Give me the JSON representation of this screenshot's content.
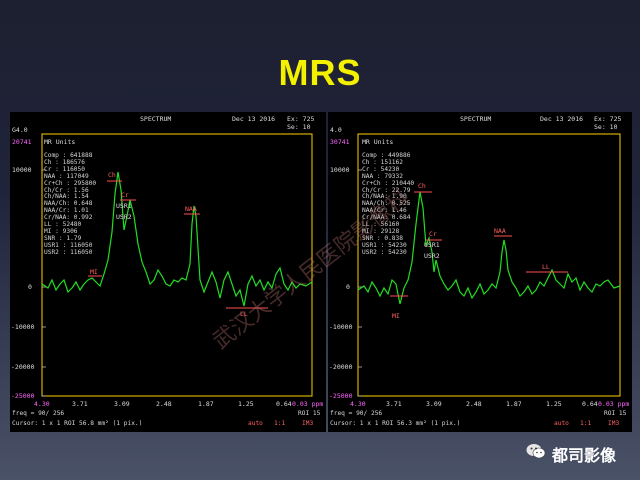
{
  "slide": {
    "title": "MRS"
  },
  "watermark": "武汉大学人民医院影像科",
  "logo": {
    "text": "都司影像",
    "icon": "wechat-icon"
  },
  "accent_color": "#f3f000",
  "spectrum_color": "#22dd22",
  "panels": [
    {
      "header": {
        "spectrum": "SPECTRUM",
        "date": "Dec 13 2016",
        "ex": "Ex: 725",
        "se": "Se: 10",
        "top_left": "G4.0",
        "ymax": "20741",
        "units": "MR Units"
      },
      "stats": [
        "Comp  : 641888",
        "Ch    : 186576",
        "Cr    : 116050",
        "NAA   : 117049",
        "Cr+Ch : 295800",
        "Ch/Cr : 1.56",
        "Ch/NAA: 1.54",
        "NAA/Ch: 0.648",
        "NAA/Cr: 1.01",
        "Cr/NAA: 0.992",
        "LL    : 52480",
        "MI    : 9306",
        "SNR   : 1.79",
        "USR1  : 116050",
        "USR2  : 116050"
      ],
      "y_ticks": [
        "10000",
        "0",
        "-10000",
        "-20000",
        "-25000"
      ],
      "x_ticks": [
        "4.30",
        "3.71",
        "3.09",
        "2.48",
        "1.87",
        "1.25",
        "0.64",
        "0.03 ppm"
      ],
      "peak_labels": {
        "ch": "Ch",
        "cr": "Cr",
        "usr1": "USR1",
        "usr2": "USR2",
        "naa": "NAA",
        "mi": "MI",
        "ll": "LL"
      },
      "footer": {
        "freq": "freq = 90/ 256",
        "roi": "ROI 15",
        "cursor": "Cursor: 1 x 1  ROI 56.8 mm² (1 pix.)",
        "auto": "auto",
        "ratio": "1:1",
        "im": "IM3"
      }
    },
    {
      "header": {
        "spectrum": "SPECTRUM",
        "date": "Dec 13 2016",
        "ex": "Ex: 725",
        "se": "Se: 10",
        "top_left": "4.0",
        "ymax": "30741",
        "units": "MR Units"
      },
      "stats": [
        "Comp  : 449886",
        "Ch    : 151162",
        "Cr    : 54230",
        "NAA   : 79332",
        "Cr+Ch : 210440",
        "Ch/Cr : 22.79",
        "Ch/NAA: 1.90",
        "NAA/Ch: 0.525",
        "NAA/Cr: 1.46",
        "Cr/NAA: 0.684",
        "LL    : 56160",
        "MI    : 29128",
        "SNR   : 0.838",
        "USR1  : 54230",
        "USR2  : 54230"
      ],
      "y_ticks": [
        "10000",
        "0",
        "-10000",
        "-20000",
        "-25000"
      ],
      "x_ticks": [
        "4.30",
        "3.71",
        "3.09",
        "2.48",
        "1.87",
        "1.25",
        "0.64",
        "0.03 ppm"
      ],
      "peak_labels": {
        "ch": "Ch",
        "cr": "Cr",
        "usr1": "USR1",
        "usr2": "USR2",
        "naa": "NAA",
        "mi": "MI",
        "ll": "LL"
      },
      "footer": {
        "freq": "freq = 90/ 256",
        "roi": "ROI 15",
        "cursor": "Cursor: 1 x 1  ROI 56.3 mm² (1 pix.)",
        "auto": "auto",
        "ratio": "1:1",
        "im": "IM3"
      }
    }
  ]
}
